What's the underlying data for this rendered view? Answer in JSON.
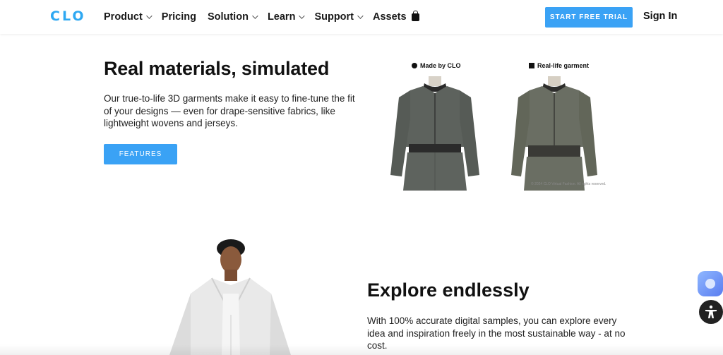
{
  "header": {
    "logo": "CLO",
    "nav": [
      {
        "label": "Product",
        "has_dropdown": true
      },
      {
        "label": "Pricing",
        "has_dropdown": false
      },
      {
        "label": "Solution",
        "has_dropdown": true
      },
      {
        "label": "Learn",
        "has_dropdown": true
      },
      {
        "label": "Support",
        "has_dropdown": true
      },
      {
        "label": "Assets",
        "has_dropdown": false
      }
    ],
    "trial_label": "START FREE TRIAL",
    "signin_label": "Sign In"
  },
  "section1": {
    "title": "Real materials, simulated",
    "body": "Our true-to-life 3D garments make it easy to fine-tune the fit of your designs — even for drape-sensitive fabrics, like lightweight wovens and jerseys.",
    "button_label": "FEATURES",
    "caption_left": "Made by CLO",
    "caption_right": "Real-life garment",
    "copyright": "© 2024 CLO Virtual Fashion. All rights reserved."
  },
  "section2": {
    "title": "Explore endlessly",
    "body": "With 100% accurate digital samples, you can explore every idea and inspiration freely in the most sustainable way - at no cost."
  },
  "icons": {
    "nav_assets": "shopping-bag-icon",
    "chat": "chat-assistant-icon",
    "accessibility": "accessibility-icon"
  },
  "colors": {
    "accent": "#3aa2f5",
    "logo": "#2ea8f2"
  }
}
